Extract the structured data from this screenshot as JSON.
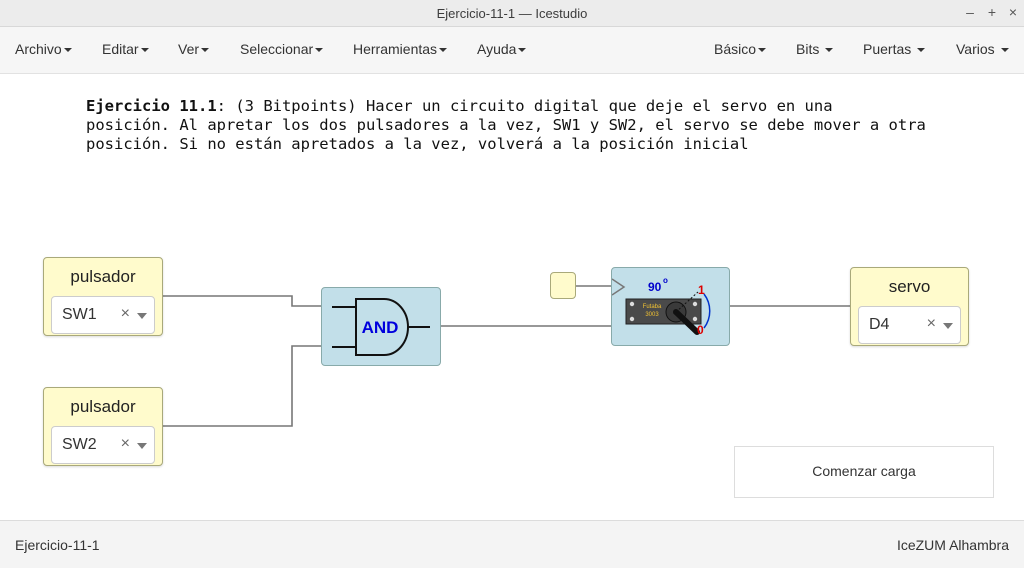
{
  "window": {
    "title": "Ejercicio-11-1 — Icestudio",
    "controls": [
      "–",
      "+",
      "×"
    ]
  },
  "menu": {
    "left": [
      "Archivo",
      "Editar",
      "Ver",
      "Seleccionar",
      "Herramientas",
      "Ayuda"
    ],
    "right": [
      "Básico",
      "Bits",
      "Puertas",
      "Varios"
    ]
  },
  "description": {
    "bold": "Ejercicio 11.1",
    "line1": ": (3 Bitpoints) Hacer un circuito digital que deje el servo en una",
    "line2": "posición. Al apretar los dos pulsadores a la vez, SW1 y SW2, el servo se debe mover a otra",
    "line3": "posición. Si no están apretados a la vez, volverá a la posición inicial"
  },
  "blocks": {
    "input1": {
      "label": "pulsador",
      "value": "SW1",
      "clear": "×"
    },
    "input2": {
      "label": "pulsador",
      "value": "SW2",
      "clear": "×"
    },
    "and_gate": {
      "label": "AND"
    },
    "servo_block": {
      "angle": "90",
      "degree": "o",
      "state_high": "1",
      "state_low": "0",
      "brand": "Futaba",
      "model": "3003"
    },
    "output": {
      "label": "servo",
      "value": "D4",
      "clear": "×"
    }
  },
  "load_button": "Comenzar carga",
  "status": {
    "left": "Ejercicio-11-1",
    "right": "IceZUM Alhambra"
  },
  "colors": {
    "io_block": "#fffbcc",
    "gate_block": "#c2dfe9",
    "wire": "#777777",
    "and_text": "#0000dd"
  }
}
